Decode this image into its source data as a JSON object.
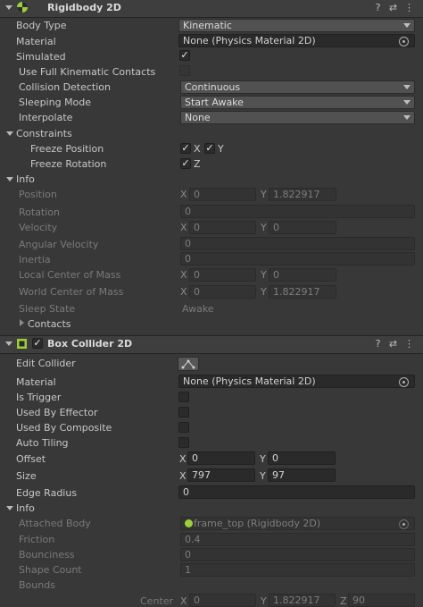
{
  "rigidbody": {
    "title": "Rigidbody 2D",
    "body_type_label": "Body Type",
    "body_type_value": "Kinematic",
    "material_label": "Material",
    "material_value": "None (Physics Material 2D)",
    "simulated_label": "Simulated",
    "simulated_checked": true,
    "full_kinematic_label": "Use Full Kinematic Contacts",
    "collision_label": "Collision Detection",
    "collision_value": "Continuous",
    "sleeping_label": "Sleeping Mode",
    "sleeping_value": "Start Awake",
    "interpolate_label": "Interpolate",
    "interpolate_value": "None",
    "constraints_label": "Constraints",
    "freeze_position_label": "Freeze Position",
    "freeze_rotation_label": "Freeze Rotation",
    "x_axis": "X",
    "y_axis": "Y",
    "z_axis": "Z",
    "info_label": "Info",
    "position_label": "Position",
    "position_x": "0",
    "position_y": "1.822917",
    "rotation_label": "Rotation",
    "rotation_value": "0",
    "velocity_label": "Velocity",
    "velocity_x": "0",
    "velocity_y": "0",
    "angular_velocity_label": "Angular Velocity",
    "angular_velocity_value": "0",
    "inertia_label": "Inertia",
    "inertia_value": "0",
    "local_com_label": "Local Center of Mass",
    "local_com_x": "0",
    "local_com_y": "0",
    "world_com_label": "World Center of Mass",
    "world_com_x": "0",
    "world_com_y": "1.822917",
    "sleep_state_label": "Sleep State",
    "sleep_state_value": "Awake",
    "contacts_label": "Contacts"
  },
  "box_collider": {
    "title": "Box Collider 2D",
    "edit_collider_label": "Edit Collider",
    "material_label": "Material",
    "material_value": "None (Physics Material 2D)",
    "is_trigger_label": "Is Trigger",
    "used_by_effector_label": "Used By Effector",
    "used_by_composite_label": "Used By Composite",
    "auto_tiling_label": "Auto Tiling",
    "offset_label": "Offset",
    "offset_x": "0",
    "offset_y": "0",
    "size_label": "Size",
    "size_x": "797",
    "size_y": "97",
    "edge_radius_label": "Edge Radius",
    "edge_radius_value": "0",
    "info_label": "Info",
    "attached_body_label": "Attached Body",
    "attached_body_value": "frame_top (Rigidbody 2D)",
    "friction_label": "Friction",
    "friction_value": "0.4",
    "bounciness_label": "Bounciness",
    "bounciness_value": "0",
    "shape_count_label": "Shape Count",
    "shape_count_value": "1",
    "bounds_label": "Bounds",
    "center_label": "Center",
    "center_x": "0",
    "center_y": "1.822917",
    "center_z": "90"
  },
  "icons": [
    "help-icon",
    "presets-icon",
    "more-options-icon",
    "object-picker-icon",
    "edit-collider-icon",
    "rigidbody-icon",
    "box-collider-icon"
  ],
  "colors": {
    "background": "#383838",
    "field": "#2a2a2a",
    "header": "#3e3e3e",
    "component_icon": "#9ccf3c"
  }
}
